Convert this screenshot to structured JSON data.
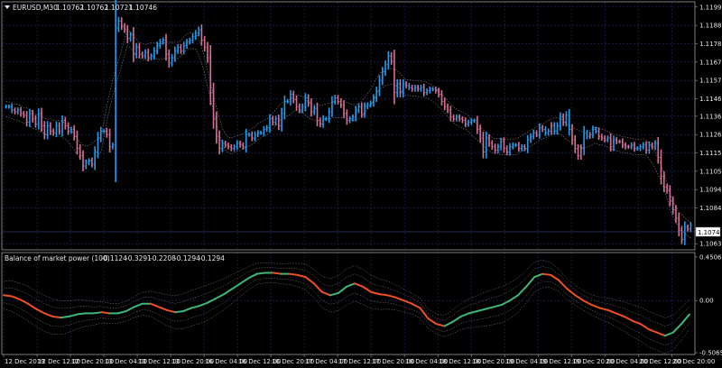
{
  "main_chart": {
    "symbol": "EURUSD,M30",
    "ohlc": [
      "1.10762",
      "1.10762",
      "1.10721",
      "1.10746"
    ],
    "collapse_icon": "triangle-down-icon",
    "current_price": "1.10746",
    "price_labels": [
      "1.11990",
      "1.11885",
      "1.11780",
      "1.11675",
      "1.11570",
      "1.11465",
      "1.11365",
      "1.11260",
      "1.11155",
      "1.11050",
      "1.10945",
      "1.10840",
      "1.10635"
    ],
    "ylim": [
      1.106,
      1.1202
    ]
  },
  "indicator": {
    "title": "Balance of market power (100)",
    "values": [
      "-0.1124",
      "-0.3291",
      "-0.2208",
      "-0.1294",
      "-0.1294"
    ],
    "scale_labels": [
      "0.4506",
      "0.00",
      "-0.5065"
    ],
    "ylim": [
      -0.5065,
      0.4506
    ]
  },
  "time_axis": {
    "labels": [
      "12 Dec 2019",
      "12 Dec 12:00",
      "12 Dec 20:00",
      "13 Dec 04:00",
      "13 Dec 12:00",
      "13 Dec 20:00",
      "16 Dec 04:00",
      "16 Dec 12:00",
      "16 Dec 20:00",
      "17 Dec 04:00",
      "17 Dec 12:00",
      "17 Dec 20:00",
      "18 Dec 04:00",
      "18 Dec 12:00",
      "18 Dec 20:00",
      "19 Dec 04:00",
      "19 Dec 12:00",
      "19 Dec 20:00",
      "20 Dec 04:00",
      "20 Dec 12:00",
      "20 Dec 20:00"
    ]
  },
  "colors": {
    "background": "#000000",
    "grid": "#1c2a6a",
    "up": "#1e9ef0",
    "down": "#d86f96",
    "indicator_up": "#3cb878",
    "indicator_down": "#f05020",
    "envelope": "#808080"
  },
  "chart_data": [
    {
      "type": "bar",
      "name": "EURUSD,M30",
      "close": [
        1.1142,
        1.1142,
        1.114,
        1.1139,
        1.114,
        1.1138,
        1.1137,
        1.1133,
        1.1138,
        1.1135,
        1.1132,
        1.1138,
        1.1131,
        1.1126,
        1.1131,
        1.1128,
        1.1127,
        1.1131,
        1.1128,
        1.1134,
        1.1131,
        1.1128,
        1.1129,
        1.1125,
        1.1118,
        1.1114,
        1.1108,
        1.111,
        1.1111,
        1.1109,
        1.1116,
        1.1124,
        1.1128,
        1.1128,
        1.1126,
        1.1119,
        1.112,
        1.1187,
        1.1191,
        1.1188,
        1.1186,
        1.1181,
        1.1183,
        1.1172,
        1.1176,
        1.1172,
        1.1171,
        1.1173,
        1.117,
        1.1171,
        1.1174,
        1.1177,
        1.1179,
        1.118,
        1.1172,
        1.1167,
        1.117,
        1.1174,
        1.1176,
        1.1174,
        1.1177,
        1.1179,
        1.118,
        1.1182,
        1.1184,
        1.1186,
        1.118,
        1.1176,
        1.117,
        1.115,
        1.1135,
        1.1125,
        1.1118,
        1.1121,
        1.112,
        1.1119,
        1.1118,
        1.1119,
        1.1121,
        1.112,
        1.1119,
        1.1126,
        1.1126,
        1.1124,
        1.1126,
        1.1127,
        1.1127,
        1.1129,
        1.113,
        1.1135,
        1.1133,
        1.1135,
        1.1131,
        1.1138,
        1.1145,
        1.1145,
        1.1149,
        1.1146,
        1.1142,
        1.114,
        1.1142,
        1.1147,
        1.1144,
        1.1139,
        1.1141,
        1.1134,
        1.1132,
        1.1135,
        1.1135,
        1.1139,
        1.1145,
        1.1147,
        1.1145,
        1.1143,
        1.1138,
        1.1134,
        1.1135,
        1.1136,
        1.114,
        1.1142,
        1.1138,
        1.1142,
        1.1143,
        1.1144,
        1.1147,
        1.1151,
        1.1157,
        1.1162,
        1.1166,
        1.1171,
        1.1168,
        1.115,
        1.1155,
        1.115,
        1.1155,
        1.1154,
        1.1153,
        1.1152,
        1.1153,
        1.1152,
        1.1153,
        1.115,
        1.1151,
        1.1152,
        1.1152,
        1.1151,
        1.1149,
        1.1145,
        1.1142,
        1.114,
        1.1136,
        1.1135,
        1.1136,
        1.1135,
        1.1134,
        1.1132,
        1.1133,
        1.1134,
        1.1134,
        1.1129,
        1.1124,
        1.1116,
        1.1124,
        1.1121,
        1.1119,
        1.1117,
        1.1119,
        1.1122,
        1.1118,
        1.1116,
        1.1119,
        1.112,
        1.112,
        1.1118,
        1.1119,
        1.1118,
        1.1123,
        1.1125,
        1.1127,
        1.1126,
        1.113,
        1.1129,
        1.1127,
        1.1128,
        1.1131,
        1.1128,
        1.1131,
        1.1136,
        1.1133,
        1.1137,
        1.1129,
        1.1123,
        1.1118,
        1.1114,
        1.1118,
        1.1127,
        1.1125,
        1.1126,
        1.1129,
        1.1128,
        1.1125,
        1.1124,
        1.1123,
        1.1124,
        1.1119,
        1.1123,
        1.1122,
        1.1122,
        1.112,
        1.1119,
        1.1119,
        1.112,
        1.1118,
        1.1118,
        1.1119,
        1.112,
        1.1117,
        1.112,
        1.1119,
        1.1121,
        1.1113,
        1.1102,
        1.1096,
        1.1094,
        1.1088,
        1.1083,
        1.1078,
        1.1071,
        1.1066,
        1.1073,
        1.1072,
        1.1074
      ],
      "dir": [
        1,
        1,
        1,
        0,
        1,
        0,
        0,
        0,
        1,
        0,
        0,
        1,
        0,
        0,
        1,
        0,
        0,
        1,
        0,
        1,
        0,
        0,
        1,
        0,
        0,
        0,
        0,
        1,
        1,
        0,
        1,
        1,
        1,
        1,
        0,
        0,
        1,
        1,
        1,
        0,
        0,
        0,
        1,
        0,
        1,
        0,
        0,
        1,
        0,
        1,
        1,
        1,
        1,
        1,
        0,
        0,
        1,
        1,
        1,
        0,
        1,
        1,
        1,
        1,
        1,
        1,
        0,
        0,
        0,
        0,
        0,
        0,
        0,
        1,
        0,
        0,
        0,
        1,
        1,
        0,
        0,
        1,
        1,
        0,
        1,
        1,
        1,
        1,
        1,
        1,
        0,
        1,
        0,
        1,
        1,
        1,
        1,
        0,
        0,
        0,
        1,
        1,
        0,
        0,
        1,
        0,
        0,
        1,
        1,
        1,
        1,
        1,
        0,
        0,
        0,
        0,
        1,
        1,
        1,
        1,
        0,
        1,
        1,
        1,
        1,
        1,
        1,
        1,
        1,
        1,
        0,
        0,
        1,
        0,
        1,
        0,
        1,
        0,
        1,
        0,
        1,
        0,
        1,
        1,
        1,
        0,
        0,
        0,
        0,
        0,
        0,
        0,
        1,
        0,
        0,
        0,
        1,
        1,
        1,
        0,
        0,
        0,
        1,
        0,
        0,
        0,
        1,
        1,
        0,
        0,
        1,
        1,
        1,
        0,
        1,
        0,
        1,
        1,
        1,
        0,
        1,
        0,
        1,
        1,
        0,
        1,
        1,
        1,
        0,
        1,
        1,
        0,
        0,
        0,
        0,
        1,
        1,
        0,
        1,
        1,
        0,
        0,
        0,
        1,
        0,
        1,
        0,
        0,
        0,
        0,
        0,
        1,
        0,
        1,
        1,
        1,
        0,
        1,
        0,
        1,
        0,
        0,
        0,
        0,
        0,
        0,
        0,
        0,
        0,
        1,
        0,
        1
      ]
    },
    {
      "type": "line",
      "name": "Balance of market power (100)",
      "values": [
        0.05,
        0.04,
        0.01,
        -0.03,
        -0.08,
        -0.12,
        -0.15,
        -0.16,
        -0.15,
        -0.13,
        -0.12,
        -0.12,
        -0.11,
        -0.12,
        -0.12,
        -0.1,
        -0.06,
        -0.03,
        -0.03,
        -0.06,
        -0.09,
        -0.11,
        -0.1,
        -0.07,
        -0.05,
        -0.02,
        0.02,
        0.06,
        0.11,
        0.16,
        0.21,
        0.25,
        0.26,
        0.26,
        0.25,
        0.25,
        0.24,
        0.22,
        0.16,
        0.08,
        0.05,
        0.07,
        0.13,
        0.16,
        0.13,
        0.08,
        0.06,
        0.05,
        0.03,
        0.0,
        -0.03,
        -0.07,
        -0.17,
        -0.22,
        -0.24,
        -0.2,
        -0.15,
        -0.12,
        -0.1,
        -0.08,
        -0.06,
        -0.04,
        0.0,
        0.05,
        0.13,
        0.22,
        0.25,
        0.24,
        0.19,
        0.11,
        0.05,
        0.0,
        -0.04,
        -0.07,
        -0.09,
        -0.12,
        -0.15,
        -0.19,
        -0.22,
        -0.27,
        -0.3,
        -0.33,
        -0.3,
        -0.22,
        -0.13
      ]
    }
  ]
}
